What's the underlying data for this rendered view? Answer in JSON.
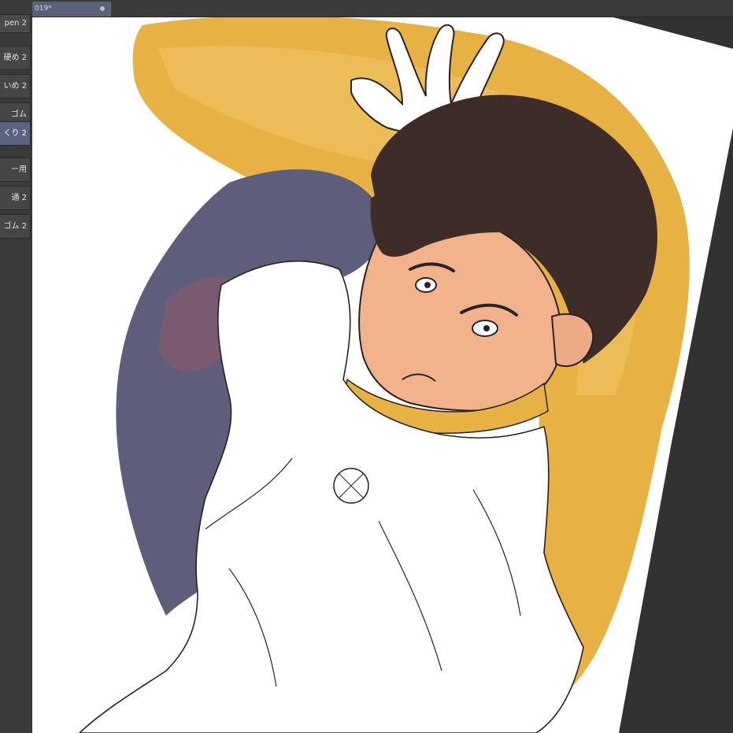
{
  "document_tab": {
    "title": "019*"
  },
  "sub_tools": [
    {
      "label": "pen 2",
      "active": false
    },
    {
      "label": "硬め 2",
      "active": false
    },
    {
      "label": "いめ 2",
      "active": false
    },
    {
      "label": "ゴム",
      "active": false
    },
    {
      "label": "くり 2",
      "active": true
    },
    {
      "label": "ー用",
      "active": false
    },
    {
      "label": "通 2",
      "active": false
    },
    {
      "label": "ゴム 2",
      "active": false
    }
  ],
  "colors": {
    "paper": "#ffffff",
    "cape_gold": "#e7b143",
    "cape_inner": "#5e5d7c",
    "skin": "#f2b28c",
    "hair": "#3d2c27",
    "line": "#2a2222",
    "active_tool": "#5a6380"
  }
}
